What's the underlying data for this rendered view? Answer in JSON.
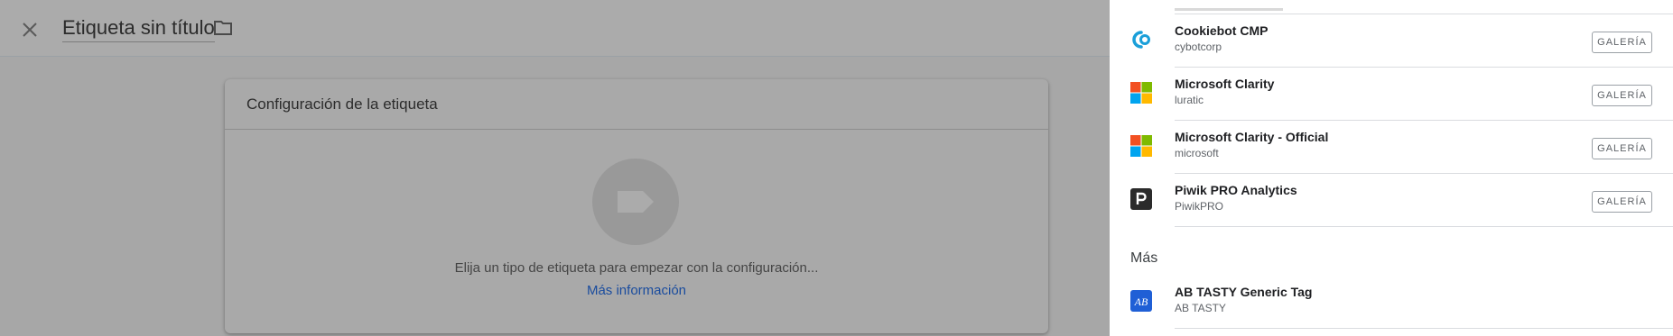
{
  "header": {
    "title": "Etiqueta sin título"
  },
  "card": {
    "title": "Configuración de la etiqueta",
    "hint": "Elija un tipo de etiqueta para empezar con la configuración...",
    "more_link": "Más información"
  },
  "panel": {
    "items": [
      {
        "name": "Cookiebot CMP",
        "vendor": "cybotcorp",
        "button": "GALERÍA",
        "icon": "cookiebot-icon"
      },
      {
        "name": "Microsoft Clarity",
        "vendor": "luratic",
        "button": "GALERÍA",
        "icon": "microsoft-icon"
      },
      {
        "name": "Microsoft Clarity - Official",
        "vendor": "microsoft",
        "button": "GALERÍA",
        "icon": "microsoft-icon"
      },
      {
        "name": "Piwik PRO Analytics",
        "vendor": "PiwikPRO",
        "button": "GALERÍA",
        "icon": "piwik-icon"
      }
    ],
    "section_title": "Más",
    "more_items": [
      {
        "name": "AB TASTY Generic Tag",
        "vendor": "AB TASTY",
        "icon": "abtasty-icon"
      }
    ]
  },
  "colors": {
    "overlay": "#a9a9a9",
    "link": "#1a4c9e",
    "cookiebot": "#1a9fd9",
    "ms_red": "#f25022",
    "ms_green": "#7fba00",
    "ms_blue": "#00a4ef",
    "ms_yellow": "#ffb900",
    "piwik": "#2b2b2b",
    "abtasty": "#1f5fd6"
  }
}
